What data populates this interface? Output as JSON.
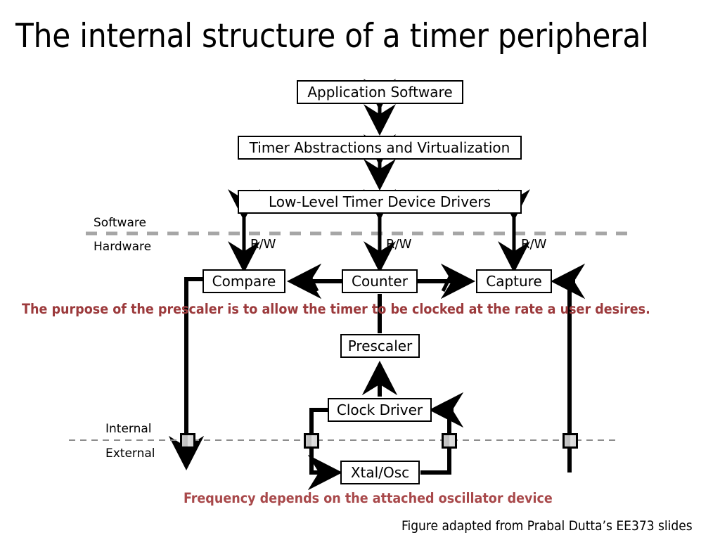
{
  "slide": {
    "title": "The internal structure of a timer peripheral",
    "accent_red": "#9C3A3C",
    "divider_gray": "#A6A6A6",
    "line_black": "#000000"
  },
  "stack": {
    "application_software": "Application Software",
    "timer_abstractions": "Timer Abstractions and Virtualization",
    "low_level_drivers": "Low-Level Timer Device Drivers"
  },
  "dividers": {
    "software_label": "Software",
    "hardware_label": "Hardware",
    "internal_label": "Internal",
    "external_label": "External"
  },
  "bus_labels": {
    "rw_compare": "R/W",
    "rw_counter": "R/W",
    "rw_capture": "R/W"
  },
  "hardware_blocks": {
    "compare": "Compare",
    "counter": "Counter",
    "capture": "Capture",
    "prescaler": "Prescaler",
    "clock_driver": "Clock Driver",
    "xtal_osc": "Xtal/Osc"
  },
  "annotations": {
    "prescaler_note": "The purpose of the prescaler is to allow the timer to be clocked at the rate a user desires.",
    "frequency_note": "Frequency depends on the attached oscillator device",
    "credit": "Figure adapted from Prabal Dutta’s EE373 slides"
  }
}
